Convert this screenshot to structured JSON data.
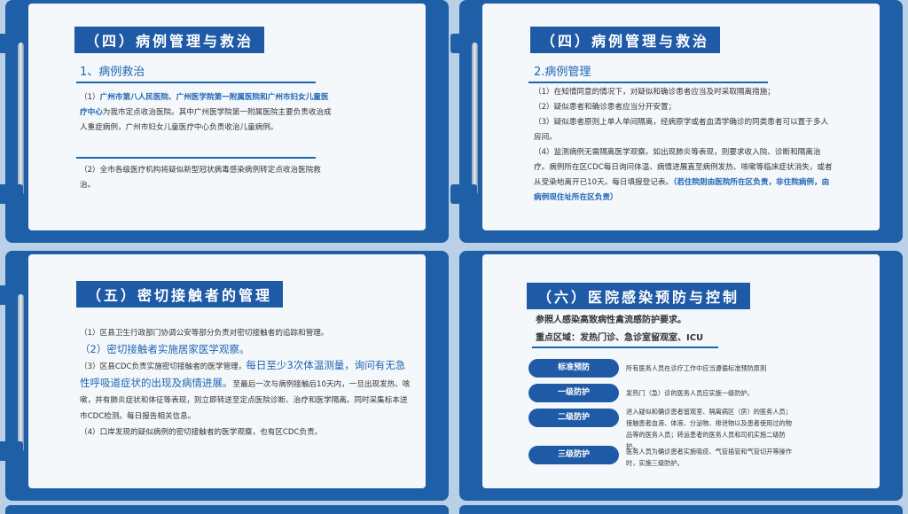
{
  "slide1": {
    "title": "（四）病例管理与救治",
    "subtitle": "1、病例救治",
    "p1_prefix": "（1）",
    "p1_bold": "广州市第八人民医院、广州医学院第一附属医院和广州市妇女儿童医疗中心",
    "p1_rest": "为我市定点收治医院。其中广州医学院第一附属医院主要负责收治成人重症病例，广州市妇女儿童医疗中心负责收治儿童病例。",
    "p2": "（2）全市各级医疗机构将疑似新型冠状病毒感染病例转定点收治医院救治。"
  },
  "slide2": {
    "title": "（四）病例管理与救治",
    "subtitle": "2.病例管理",
    "p1": "（1）在知情同意的情况下，对疑似和确诊患者应当及时采取隔离措施；",
    "p2": "（2）疑似患者和确诊患者应当分开安置；",
    "p3": "（3）疑似患者原则上单人单间隔离，经病原学或者血清学确诊的同类患者可以置于多人房间。",
    "p4_rest": "（4）监测病例无需隔离医学观察。如出现肺炎等表现，则要求收入院、诊断和隔离治疗。病例所在区CDC每日询问体温、病情进展直至病例发热、咳嗽等临床症状消失，或者从受染地离开已10天。每日填报登记表。",
    "p4_bold": "（若住院则由医院所在区负责，非住院病例，由病例现住址所在区负责）"
  },
  "slide3": {
    "title": "（五）密切接触者的管理",
    "p1": "（1）区县卫生行政部门协调公安等部分负责对密切接触者的追踪和管理。",
    "p2": "（2）密切接触者实施居家医学观察。",
    "p3_a": "（3）区县CDC负责实施密切接触者的医学管理，",
    "p3_b": "每日至少3次体温测量，询问有无急性呼吸道症状的出现及病情进展。",
    "p3_c": "至最后一次与病例接触后10天内，一旦出现发热、咳嗽，并有肺炎症状和体征等表现，则立即转送至定点医院诊断、治疗和医学隔离。同时采集标本送市CDC检测。每日报告相关信息。",
    "p4": "（4）口岸发现的疑似病例的密切接触者的医学观察，也有区CDC负责。"
  },
  "slide4": {
    "title": "（六）医院感染预防与控制",
    "line1": "参照人感染高致病性禽流感防护要求。",
    "line2": "重点区域：发热门诊、急诊室留观室、ICU",
    "levels": [
      {
        "label": "标准预防",
        "desc": "所有医务人员在诊疗工作中应当遵循标准预防原则"
      },
      {
        "label": "一级防护",
        "desc": "发热门（急）诊的医务人员应实施一级防护。"
      },
      {
        "label": "二级防护",
        "desc": "进入疑似和确诊患者留观室、隔离病区（房）的医务人员；接触患者血液、体液、分泌物、排泄物以及患者使用过的物品等的医务人员；转运患者的医务人员和司机实施二级防护。"
      },
      {
        "label": "三级防护",
        "desc": "医务人员为确诊患者实施吸痰、气管插管和气管切开等操作时，实施三级防护。"
      }
    ]
  }
}
